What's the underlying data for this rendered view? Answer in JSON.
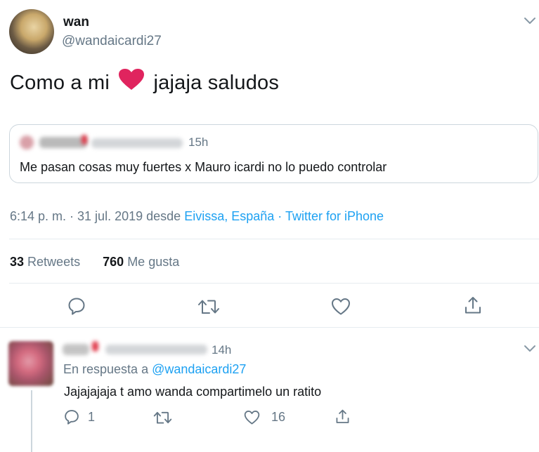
{
  "tweet": {
    "author_name": "wan",
    "author_handle": "@wandaicardi27",
    "text_before": "Como a mi",
    "text_after": "jajaja saludos",
    "quoted": {
      "time": "15h",
      "text": "Me pasan cosas muy fuertes x Mauro icardi no lo puedo controlar"
    },
    "meta": {
      "time_date": "6:14 p. m. · 31 jul. 2019 desde",
      "location": "Eivissa, España",
      "separator": "·",
      "source": "Twitter for iPhone"
    },
    "stats": {
      "retweets_count": "33",
      "retweets_label": "Retweets",
      "likes_count": "760",
      "likes_label": "Me gusta"
    }
  },
  "reply": {
    "time": "14h",
    "replying_to_label": "En respuesta a",
    "replying_to_handle": "@wandaicardi27",
    "text": "Jajajajaja t amo wanda compartimelo un ratito",
    "reply_count": "1",
    "like_count": "16"
  },
  "icons": {
    "reply": "reply-icon",
    "retweet": "retweet-icon",
    "like": "heart-icon",
    "share": "share-icon",
    "caret": "chevron-down-icon"
  },
  "colors": {
    "accent": "#1da1f2",
    "heart": "#e0245e",
    "secondary_text": "#657786",
    "border": "#e6ecf0"
  }
}
